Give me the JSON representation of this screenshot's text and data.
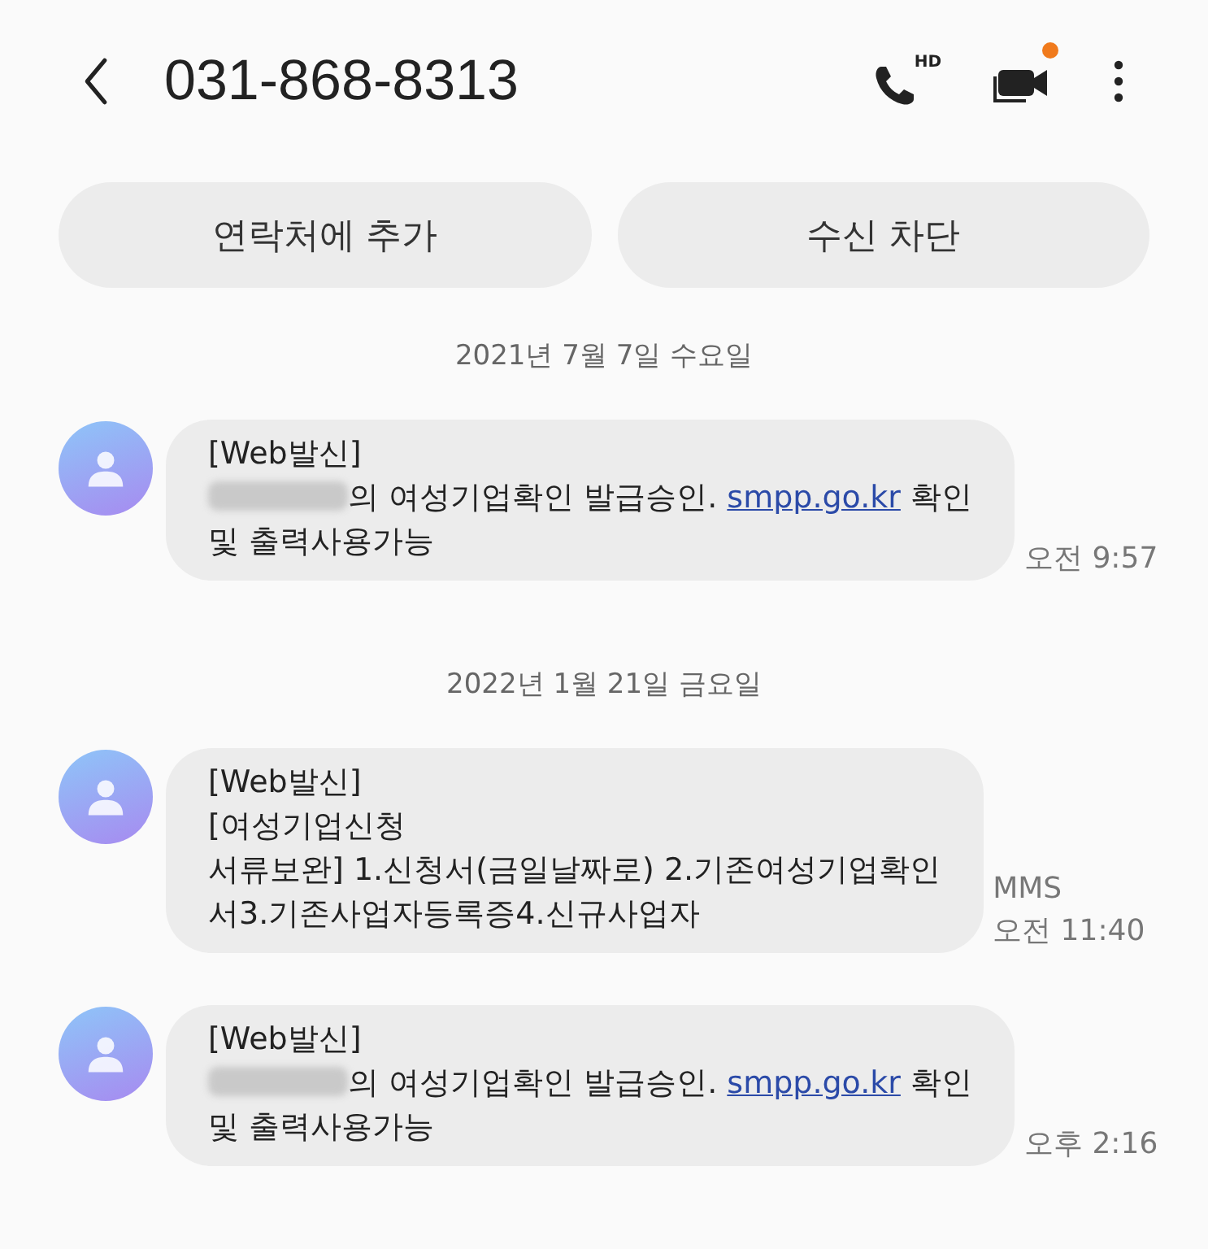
{
  "header": {
    "title": "031-868-8313",
    "video_badge": true,
    "call_label": "HD"
  },
  "actions": [
    "연락처에 추가",
    "수신 차단"
  ],
  "conversation": [
    {
      "kind": "date",
      "text": "2021년 7월 7일 수요일"
    },
    {
      "kind": "message",
      "lines": [
        [
          {
            "kind": "text",
            "text": "[Web발신]"
          }
        ],
        [
          {
            "kind": "redacted"
          },
          {
            "kind": "text",
            "text": "의 여성기업확인 발급승인. "
          },
          {
            "kind": "link",
            "text": "smpp.go.kr"
          },
          {
            "kind": "text",
            "text": " 확인"
          }
        ],
        [
          {
            "kind": "text",
            "text": "및 출력사용가능"
          }
        ]
      ],
      "time": "오전 9:57"
    },
    {
      "kind": "date",
      "text": "2022년 1월 21일 금요일"
    },
    {
      "kind": "message",
      "lines": [
        [
          {
            "kind": "text",
            "text": "[Web발신]"
          }
        ],
        [
          {
            "kind": "text",
            "text": "[여성기업신청"
          }
        ],
        [
          {
            "kind": "text",
            "text": "서류보완] 1.신청서(금일날짜로) 2.기존여성기업확인"
          }
        ],
        [
          {
            "kind": "text",
            "text": "서3.기존사업자등록증4.신규사업자"
          }
        ]
      ],
      "type_label": "MMS",
      "time": "오전 11:40"
    },
    {
      "kind": "message",
      "lines": [
        [
          {
            "kind": "text",
            "text": "[Web발신]"
          }
        ],
        [
          {
            "kind": "redacted"
          },
          {
            "kind": "text",
            "text": "의 여성기업확인 발급승인. "
          },
          {
            "kind": "link",
            "text": "smpp.go.kr"
          },
          {
            "kind": "text",
            "text": " 확인"
          }
        ],
        [
          {
            "kind": "text",
            "text": "및 출력사용가능"
          }
        ]
      ],
      "time": "오후 2:16"
    }
  ]
}
